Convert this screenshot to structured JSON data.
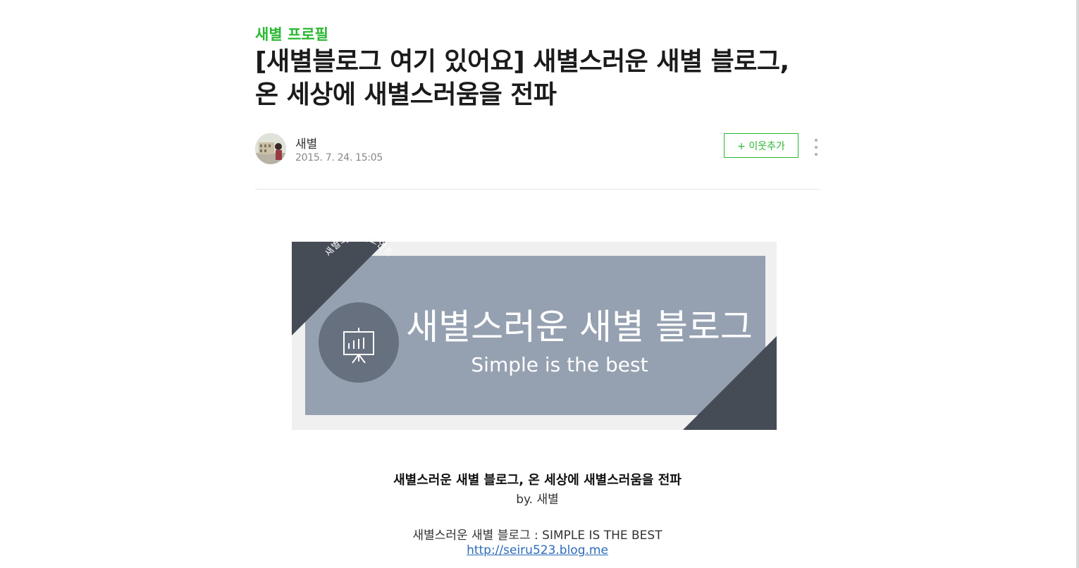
{
  "post": {
    "category": "새별 프로필",
    "title": "[새별블로그 여기 있어요] 새별스러운 새별 블로그, 온 세상에 새별스러움을 전파",
    "author": "새별",
    "date": "2015. 7. 24. 15:05",
    "follow_label": "+ 이웃추가"
  },
  "banner": {
    "main_text": "새별스러운 새별 블로그",
    "sub_text": "Simple is the best",
    "badge_text": "새별의 파워포인트",
    "colors": {
      "frame": "#f0f0f0",
      "panel": "#95a1b1",
      "corner": "#464c55",
      "badge": "#66707e"
    }
  },
  "caption": {
    "title": "새별스러운 새별 블로그, 온 세상에 새별스러움을 전파",
    "by": "by. 새별",
    "subtitle": "새별스러운 새별 블로그 : SIMPLE IS THE BEST",
    "link": "http://seiru523.blog.me"
  },
  "colors": {
    "accent": "#2bb832",
    "link": "#2d6bbb"
  },
  "icons": [
    "more-vertical-icon",
    "presentation-board-icon"
  ]
}
